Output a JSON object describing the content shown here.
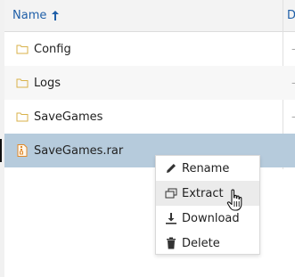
{
  "header": {
    "name_label": "Name",
    "sort_icon": "arrow-up-icon",
    "next_col_label": "D"
  },
  "rows": [
    {
      "label": "Config",
      "icon": "folder-icon",
      "trail": "-"
    },
    {
      "label": "Logs",
      "icon": "folder-icon",
      "trail": "-"
    },
    {
      "label": "SaveGames",
      "icon": "folder-icon",
      "trail": "-"
    },
    {
      "label": "SaveGames.rar",
      "icon": "archive-file-icon",
      "trail": "",
      "selected": true
    }
  ],
  "context_menu": {
    "items": [
      {
        "label": "Rename",
        "icon": "pencil-icon"
      },
      {
        "label": "Extract",
        "icon": "extract-icon",
        "hovered": true
      },
      {
        "label": "Download",
        "icon": "download-icon"
      },
      {
        "label": "Delete",
        "icon": "trash-icon"
      }
    ]
  },
  "colors": {
    "header_text": "#1f5fa8",
    "folder": "#d8b24a",
    "archive": "#e08a2a",
    "selected_row": "#b6cbdc"
  }
}
